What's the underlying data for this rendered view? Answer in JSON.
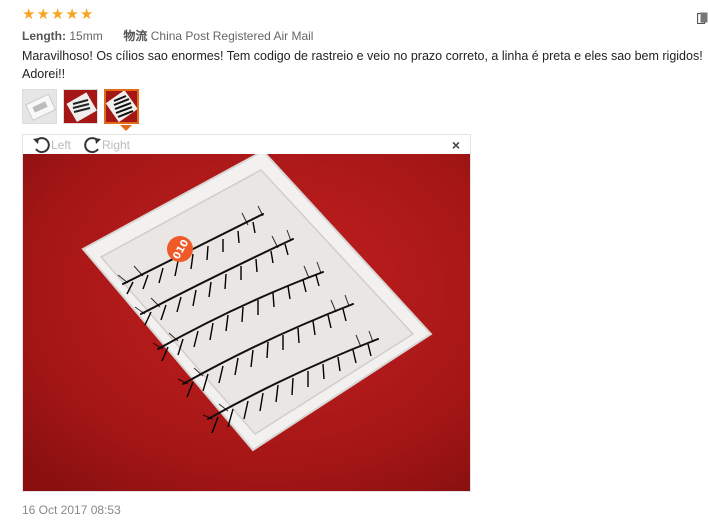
{
  "rating": {
    "stars": 5,
    "star_glyph": "★",
    "color": "#f6a623"
  },
  "meta": {
    "length_label": "Length:",
    "length_value": "15mm",
    "shipping_label": "物流",
    "shipping_value": "China Post Registered Air Mail"
  },
  "review_text": "Maravilhoso! Os cílios sao enormes! Tem codigo de rastreio e veio no prazo correto, a linha é preta e eles sao bem rigidos! Adorei!!",
  "thumbnails": [
    {
      "name": "thumbnail-1",
      "active": false
    },
    {
      "name": "thumbnail-2",
      "active": false
    },
    {
      "name": "thumbnail-3",
      "active": true
    }
  ],
  "viewer": {
    "rotate_left_label": "Left",
    "rotate_right_label": "Right",
    "close_glyph": "×",
    "badge_text": "010"
  },
  "date": "16 Oct 2017 08:53",
  "colors": {
    "accent": "#e46a1b",
    "photo_background": "#a81616",
    "tray": "#f4f2f0"
  }
}
